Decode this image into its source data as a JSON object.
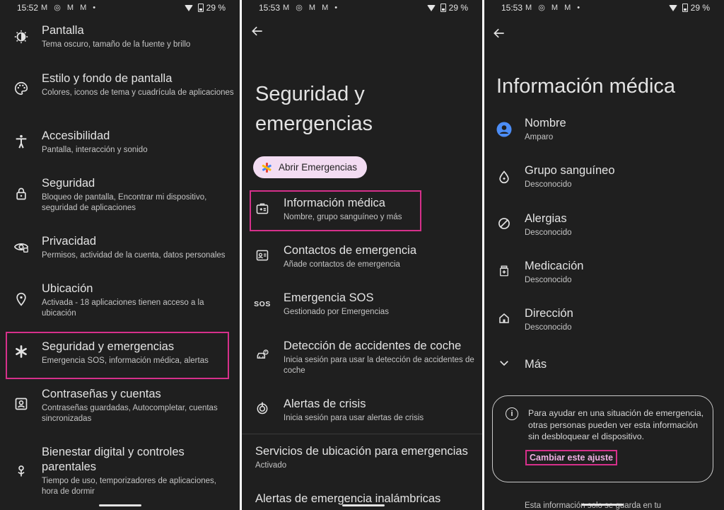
{
  "status": {
    "panel1_time": "15:52",
    "panel2_time": "15:53",
    "panel3_time": "15:53",
    "notifications_1": "M ◎ M M •",
    "notifications_2": "M ◎ M M •",
    "notifications_3": "M ◎ M M •",
    "battery": "29 %"
  },
  "settings_list": {
    "items": [
      {
        "title": "Pantalla",
        "subtitle": "Tema oscuro, tamaño de la fuente y brillo",
        "icon": "display-icon"
      },
      {
        "title": "Estilo y fondo de pantalla",
        "subtitle": "Colores, iconos de tema y cuadrícula de aplicaciones",
        "icon": "palette-icon"
      },
      {
        "title": "Accesibilidad",
        "subtitle": "Pantalla, interacción y sonido",
        "icon": "accessibility-icon"
      },
      {
        "title": "Seguridad",
        "subtitle": "Bloqueo de pantalla, Encontrar mi dispositivo, seguridad de aplicaciones",
        "icon": "lock-icon"
      },
      {
        "title": "Privacidad",
        "subtitle": "Permisos, actividad de la cuenta, datos personales",
        "icon": "privacy-eye-icon"
      },
      {
        "title": "Ubicación",
        "subtitle": "Activada - 18 aplicaciones tienen acceso a la ubicación",
        "icon": "location-pin-icon"
      },
      {
        "title": "Seguridad y emergencias",
        "subtitle": "Emergencia SOS, información médica, alertas",
        "icon": "asterisk-icon"
      },
      {
        "title": "Contraseñas y cuentas",
        "subtitle": "Contraseñas guardadas, Autocompletar, cuentas sincronizadas",
        "icon": "account-box-icon"
      },
      {
        "title": "Bienestar digital y controles parentales",
        "subtitle": "Tiempo de uso, temporizadores de aplicaciones, hora de dormir",
        "icon": "wellbeing-icon"
      }
    ]
  },
  "emergency_page": {
    "title_line1": "Seguridad y",
    "title_line2": "emergencias",
    "chip_label": "Abrir Emergencias",
    "items": [
      {
        "title": "Información médica",
        "subtitle": "Nombre, grupo sanguíneo y más",
        "icon": "medical-id-icon"
      },
      {
        "title": "Contactos de emergencia",
        "subtitle": "Añade contactos de emergencia",
        "icon": "contacts-card-icon"
      },
      {
        "title": "Emergencia SOS",
        "subtitle": "Gestionado por Emergencias",
        "icon": "sos-icon"
      },
      {
        "title": "Detección de accidentes de coche",
        "subtitle": "Inicia sesión para usar la detección de accidentes de coche",
        "icon": "car-crash-icon"
      },
      {
        "title": "Alertas de crisis",
        "subtitle": "Inicia sesión para usar alertas de crisis",
        "icon": "crisis-alert-icon"
      }
    ],
    "location_services_title": "Servicios de ubicación para emergencias",
    "location_services_status": "Activado",
    "wireless_alerts_title": "Alertas de emergencia inalámbricas"
  },
  "medical_page": {
    "title": "Información médica",
    "items": [
      {
        "title": "Nombre",
        "value": "Amparo",
        "icon": "person-circle-icon"
      },
      {
        "title": "Grupo sanguíneo",
        "value": "Desconocido",
        "icon": "blood-drop-icon"
      },
      {
        "title": "Alergias",
        "value": "Desconocido",
        "icon": "block-icon"
      },
      {
        "title": "Medicación",
        "value": "Desconocido",
        "icon": "medication-icon"
      },
      {
        "title": "Dirección",
        "value": "Desconocido",
        "icon": "home-icon"
      }
    ],
    "more_label": "Más",
    "info_text": "Para ayudar en una situación de emergencia, otras personas pueden ver esta información sin desbloquear el dispositivo.",
    "info_link": "Cambiar este ajuste",
    "bottom_text": "Esta información solo se guarda en tu"
  },
  "colors": {
    "background": "#1f1f1f",
    "highlight": "#d6308b",
    "chip": "#f3dcf2",
    "link": "#f0b0e3",
    "avatar": "#4c8df6"
  }
}
